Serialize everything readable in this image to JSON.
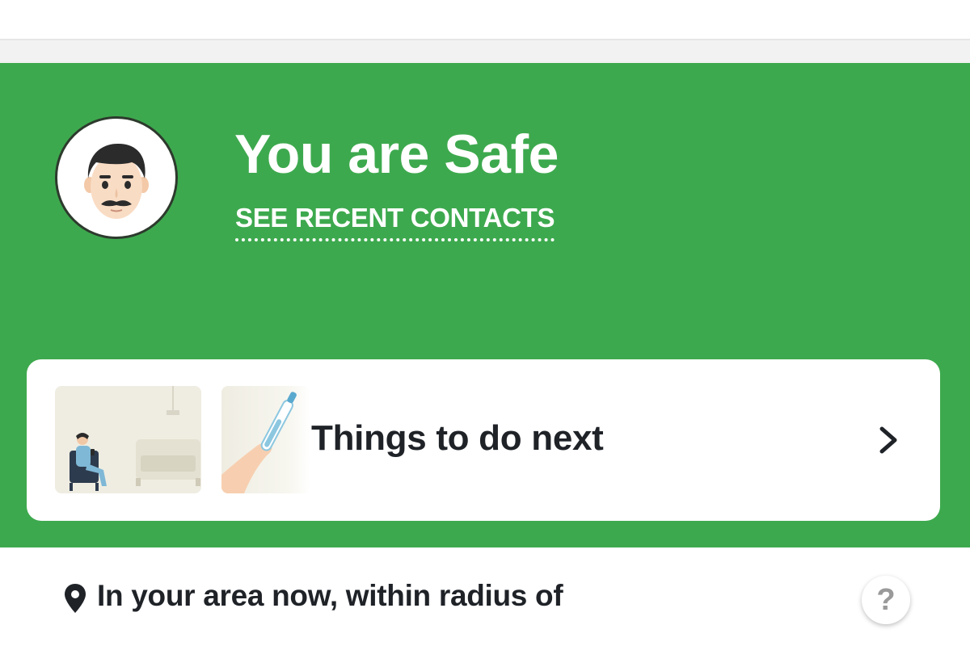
{
  "status": {
    "title": "You are Safe",
    "recent_contacts_link": "SEE RECENT CONTACTS",
    "color": "#3da94e"
  },
  "avatar": {
    "icon": "man-with-mustache-emoji"
  },
  "next_steps_card": {
    "label": "Things to do next",
    "chevron_icon": "chevron-right-icon",
    "thumbnails": [
      {
        "icon": "person-resting-at-home-illustration"
      },
      {
        "icon": "thermometer-in-hand-illustration"
      }
    ]
  },
  "area": {
    "label": "In your area now, within radius of",
    "pin_icon": "location-pin-icon",
    "help_label": "?"
  }
}
